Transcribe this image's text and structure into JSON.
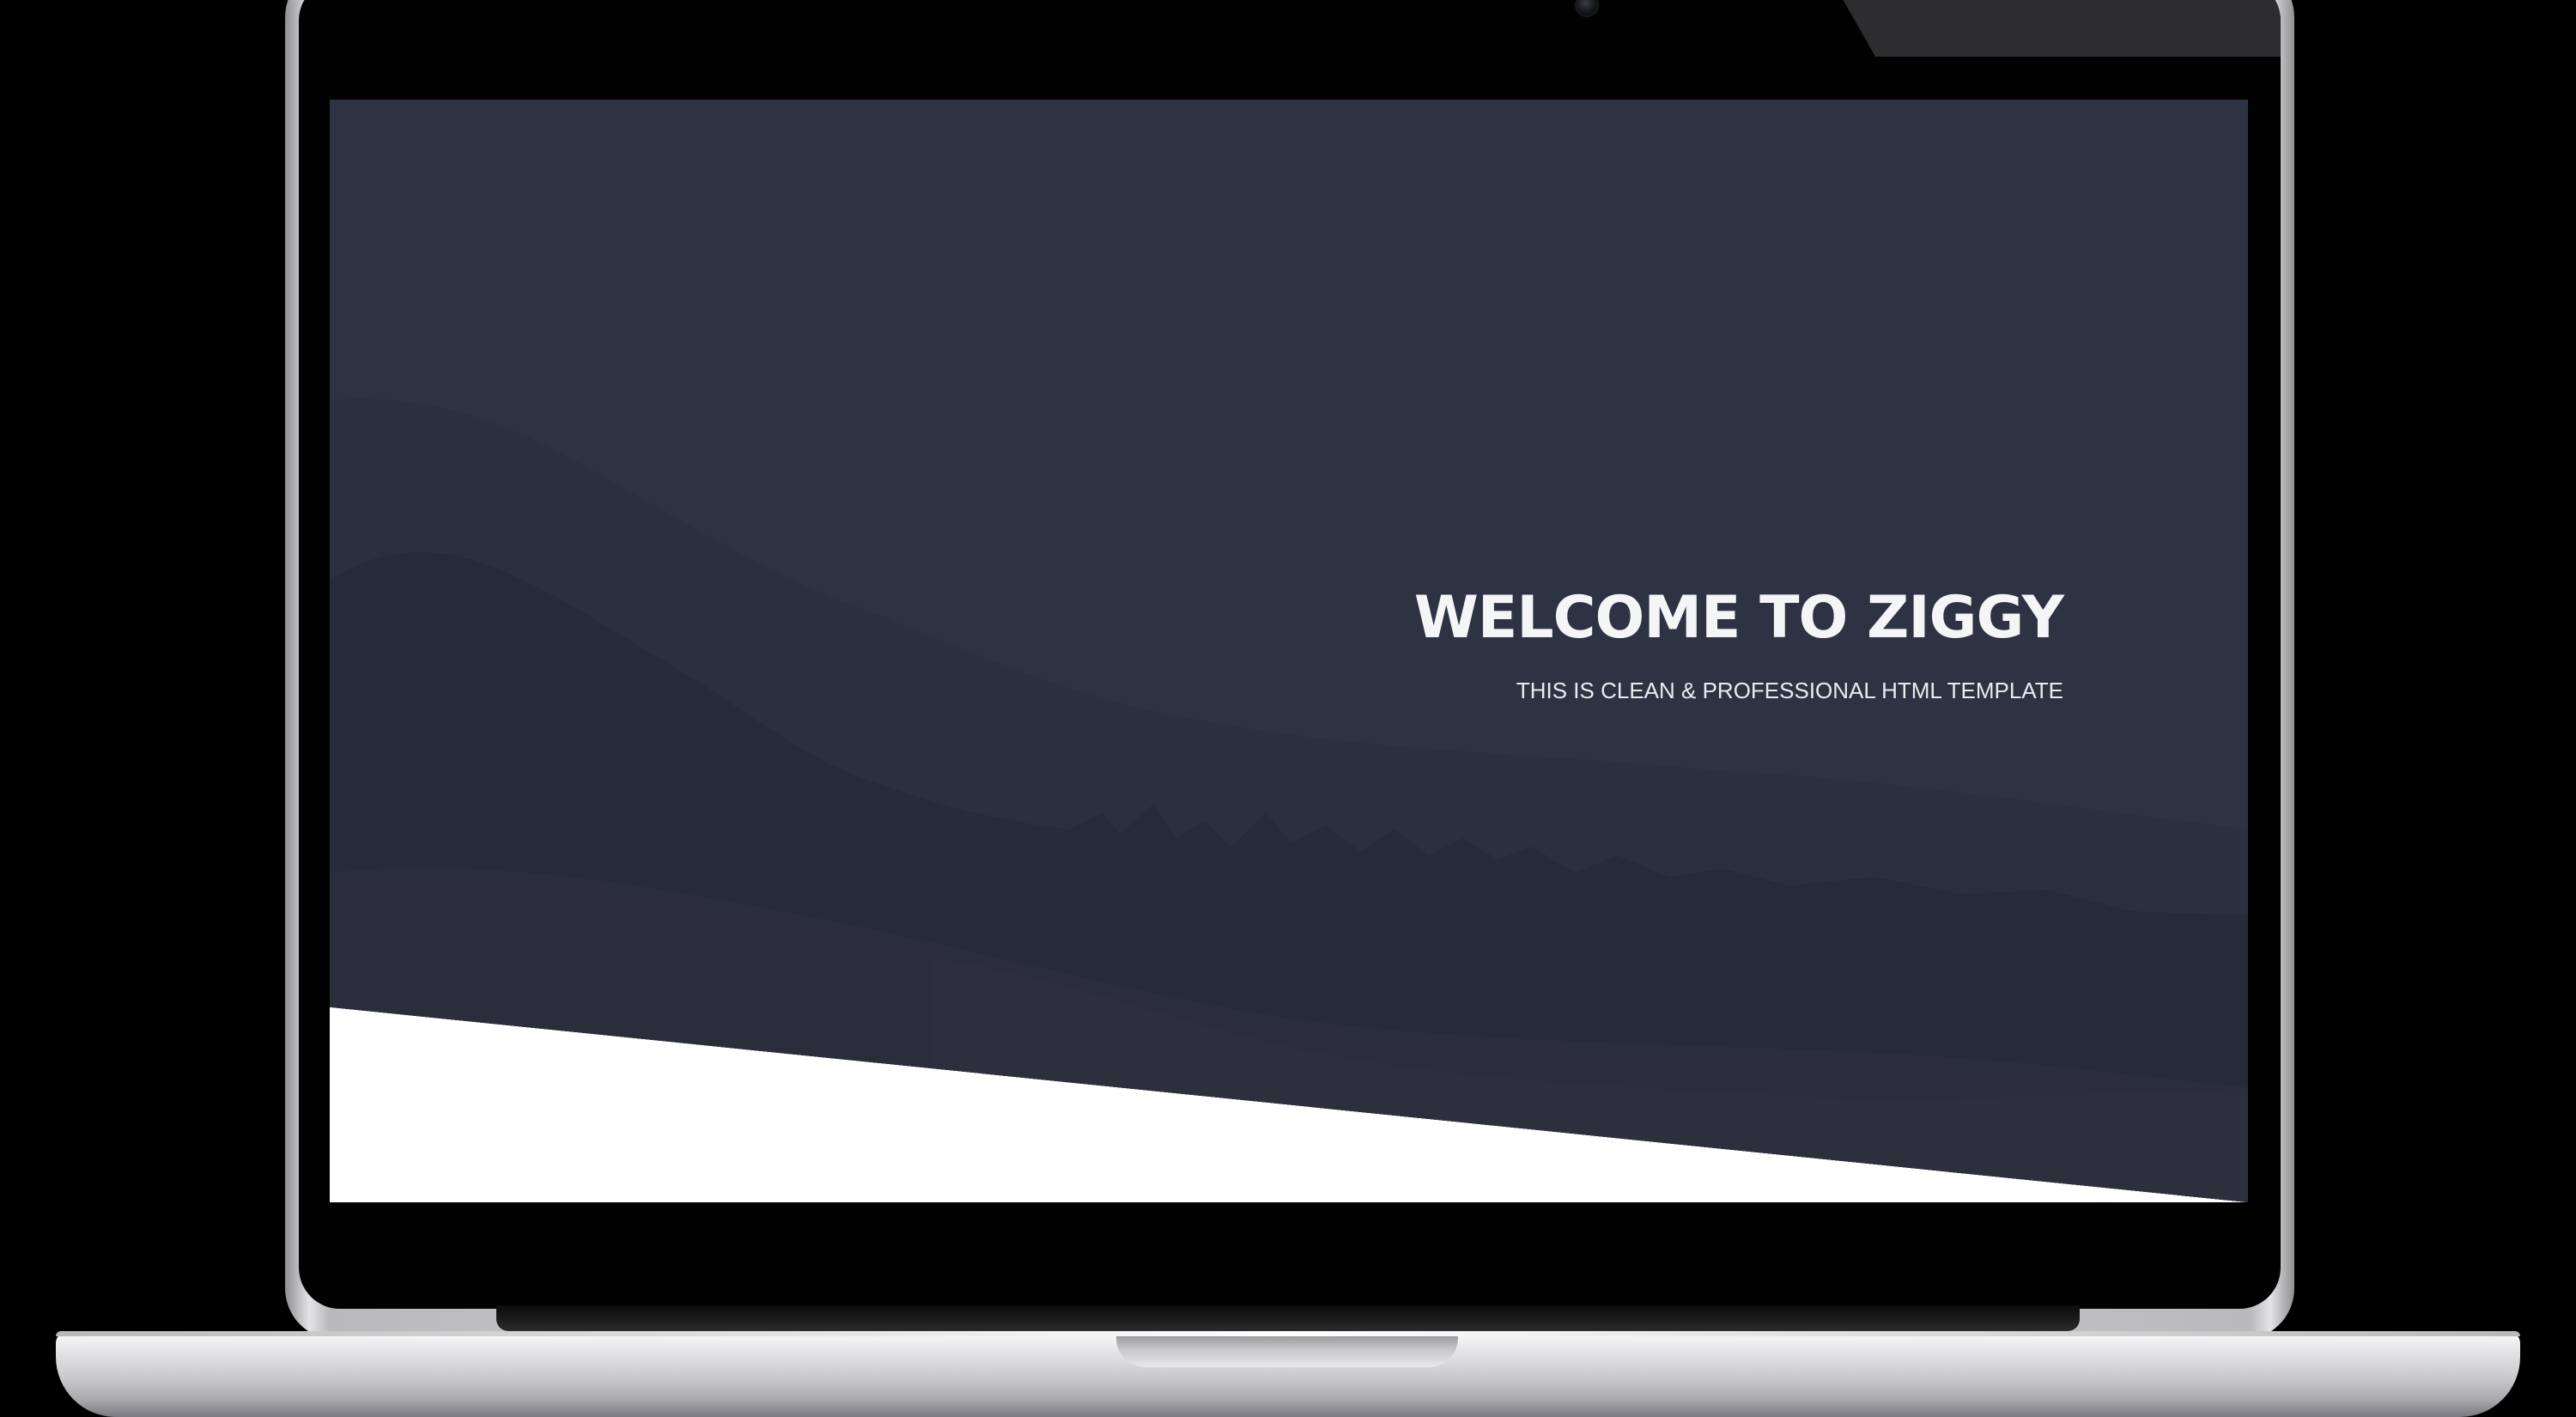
{
  "hero": {
    "title": "WELCOME TO ZIGGY",
    "subtitle": "THIS IS CLEAN & PROFESSIONAL HTML TEMPLATE"
  },
  "colors": {
    "hero_overlay": "#2d3343",
    "below_hero": "#ffffff",
    "title_text": "#f4f5f7",
    "laptop_bezel": "#020202",
    "laptop_aluminum": "#d8d8da"
  },
  "icons": {
    "camera": "webcam-dot"
  }
}
